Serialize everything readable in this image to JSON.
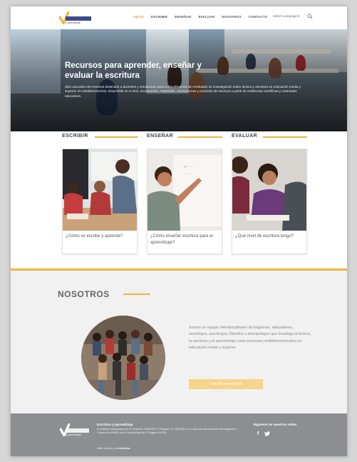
{
  "header": {
    "logo_sub": "y aprendizaje",
    "nav": [
      "INICIO",
      "ESCRIBIR",
      "ENSEÑAR",
      "EVALUAR",
      "NOSOTROS",
      "CONTACTO"
    ],
    "language": "Select Language",
    "active_nav": "INICIO"
  },
  "hero": {
    "title": "Recursos para aprender, enseñar y evaluar la escritura",
    "text": "Sitio educativo de recursos destinado a docentes y estudiantes para la transferencia de resultados de investigación sobre lectura y escritura en educación media y superior en establecimientos. Disponible en el sitio: documentos, materiales, orientaciones y prácticas de escritura a partir de evidencias científicas y materiales educativos."
  },
  "sections": [
    {
      "heading": "ESCRIBIR",
      "caption": "¿Cómo se escribe y aprende?"
    },
    {
      "heading": "ENSEÑAR",
      "caption": "¿Cómo enseñar escritura para el aprendizaje?"
    },
    {
      "heading": "EVALUAR",
      "caption": "¿Qué nivel de escritura tengo?"
    }
  ],
  "about": {
    "title": "NOSOTROS",
    "text": "Somos un equipo interdisciplinario de lingüistas, educadores, sociólogos, psicólogos, filósofos y antropólogos que investiga la lectura, la escritura y el aprendizaje como procesos multidimensionales en educación media y superior.",
    "button": "VER INFORMACIÓN"
  },
  "footer": {
    "title": "Escritura y aprendizaje",
    "desc": "A Iniciativa financiada por el Proyecto FONDECYT Regular N° 1201038 de la Agencia Nacional de Investigación y Desarrollo (ANID) de la Universidad de O'Higgins (UOH).",
    "credit_prefix": "Sitio creado por",
    "credit_name": "Inventiva",
    "social_title": "Síguenos en nuestras redes",
    "social": [
      "f",
      "t"
    ]
  },
  "colors": {
    "accent": "#f0b43c",
    "brand": "#3c4a8c",
    "footer": "#8d8e92"
  }
}
